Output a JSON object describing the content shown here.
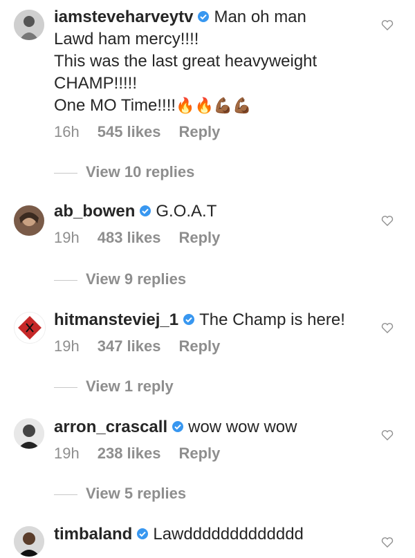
{
  "comments": [
    {
      "username": "iamsteveharvey tv",
      "username_display": "iamsteveharveytv",
      "text_lines": [
        "Man oh man",
        "Lawd ham mercy!!!!",
        "This was the last great heavyweight",
        "CHAMP!!!!!",
        "One MO Time!!!!"
      ],
      "emojis": "🔥🔥💪🏾💪🏾",
      "time": "16h",
      "likes": "545 likes",
      "reply": "Reply",
      "view_replies": "View 10 replies"
    },
    {
      "username_display": "ab_bowen",
      "text": "G.O.A.T",
      "time": "19h",
      "likes": "483 likes",
      "reply": "Reply",
      "view_replies": "View 9 replies"
    },
    {
      "username_display": "hitmansteviej_1",
      "text": "The Champ is here!",
      "time": "19h",
      "likes": "347 likes",
      "reply": "Reply",
      "view_replies": "View 1 reply"
    },
    {
      "username_display": "arron_crascall",
      "text": "wow wow wow",
      "time": "19h",
      "likes": "238 likes",
      "reply": "Reply",
      "view_replies": "View 5 replies"
    },
    {
      "username_display": "timbaland",
      "text": "Lawddddddddddddd"
    }
  ],
  "colors": {
    "text": "#262626",
    "muted": "#8e8e8e",
    "verified": "#3897f0"
  }
}
